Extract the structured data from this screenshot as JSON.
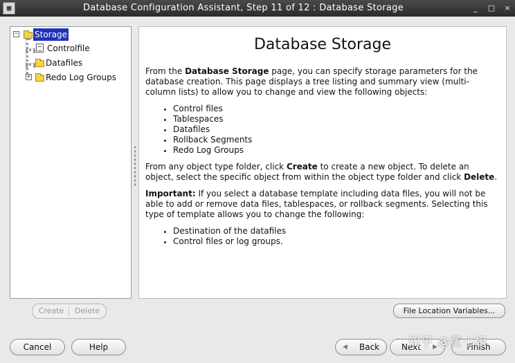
{
  "window": {
    "title": "Database Configuration Assistant, Step 11 of 12 : Database Storage",
    "app_icon": "terminal-icon",
    "controls": [
      "_",
      "□",
      "×"
    ]
  },
  "tree": {
    "root": {
      "label": "Storage",
      "expanded": true,
      "selected": true
    },
    "children": [
      {
        "label": "Controlfile",
        "icon": "document-icon"
      },
      {
        "label": "Datafiles",
        "icon": "folder-icon"
      },
      {
        "label": "Redo Log Groups",
        "icon": "folder-icon",
        "expandable": true
      }
    ]
  },
  "content": {
    "heading": "Database Storage",
    "intro": {
      "pre": "From the ",
      "bold": "Database Storage",
      "post": " page, you can specify storage parameters for the database creation. This page displays a tree listing and summary view (multi-column lists) to allow you to change and view the following objects:"
    },
    "objects": [
      "Control files",
      "Tablespaces",
      "Datafiles",
      "Rollback Segments",
      "Redo Log Groups"
    ],
    "create_delete": {
      "a": "From any object type folder, click ",
      "b": "Create",
      "c": " to create a new object. To delete an object, select the specific object from within the object type folder and click ",
      "d": "Delete",
      "e": "."
    },
    "important": {
      "label": "Important:",
      "text": " If you select a database template including data files, you will not be able to add or remove data files, tablespaces, or rollback segments. Selecting this type of template allows you to change the following:"
    },
    "changeables": [
      "Destination of the datafiles",
      "Control files or log groups."
    ]
  },
  "buttons": {
    "create": "Create",
    "delete": "Delete",
    "file_location": "File Location Variables...",
    "cancel": "Cancel",
    "help": "Help",
    "back": "Back",
    "next": "Next",
    "finish": "Finish"
  },
  "watermark": "知乎 @董小姐"
}
